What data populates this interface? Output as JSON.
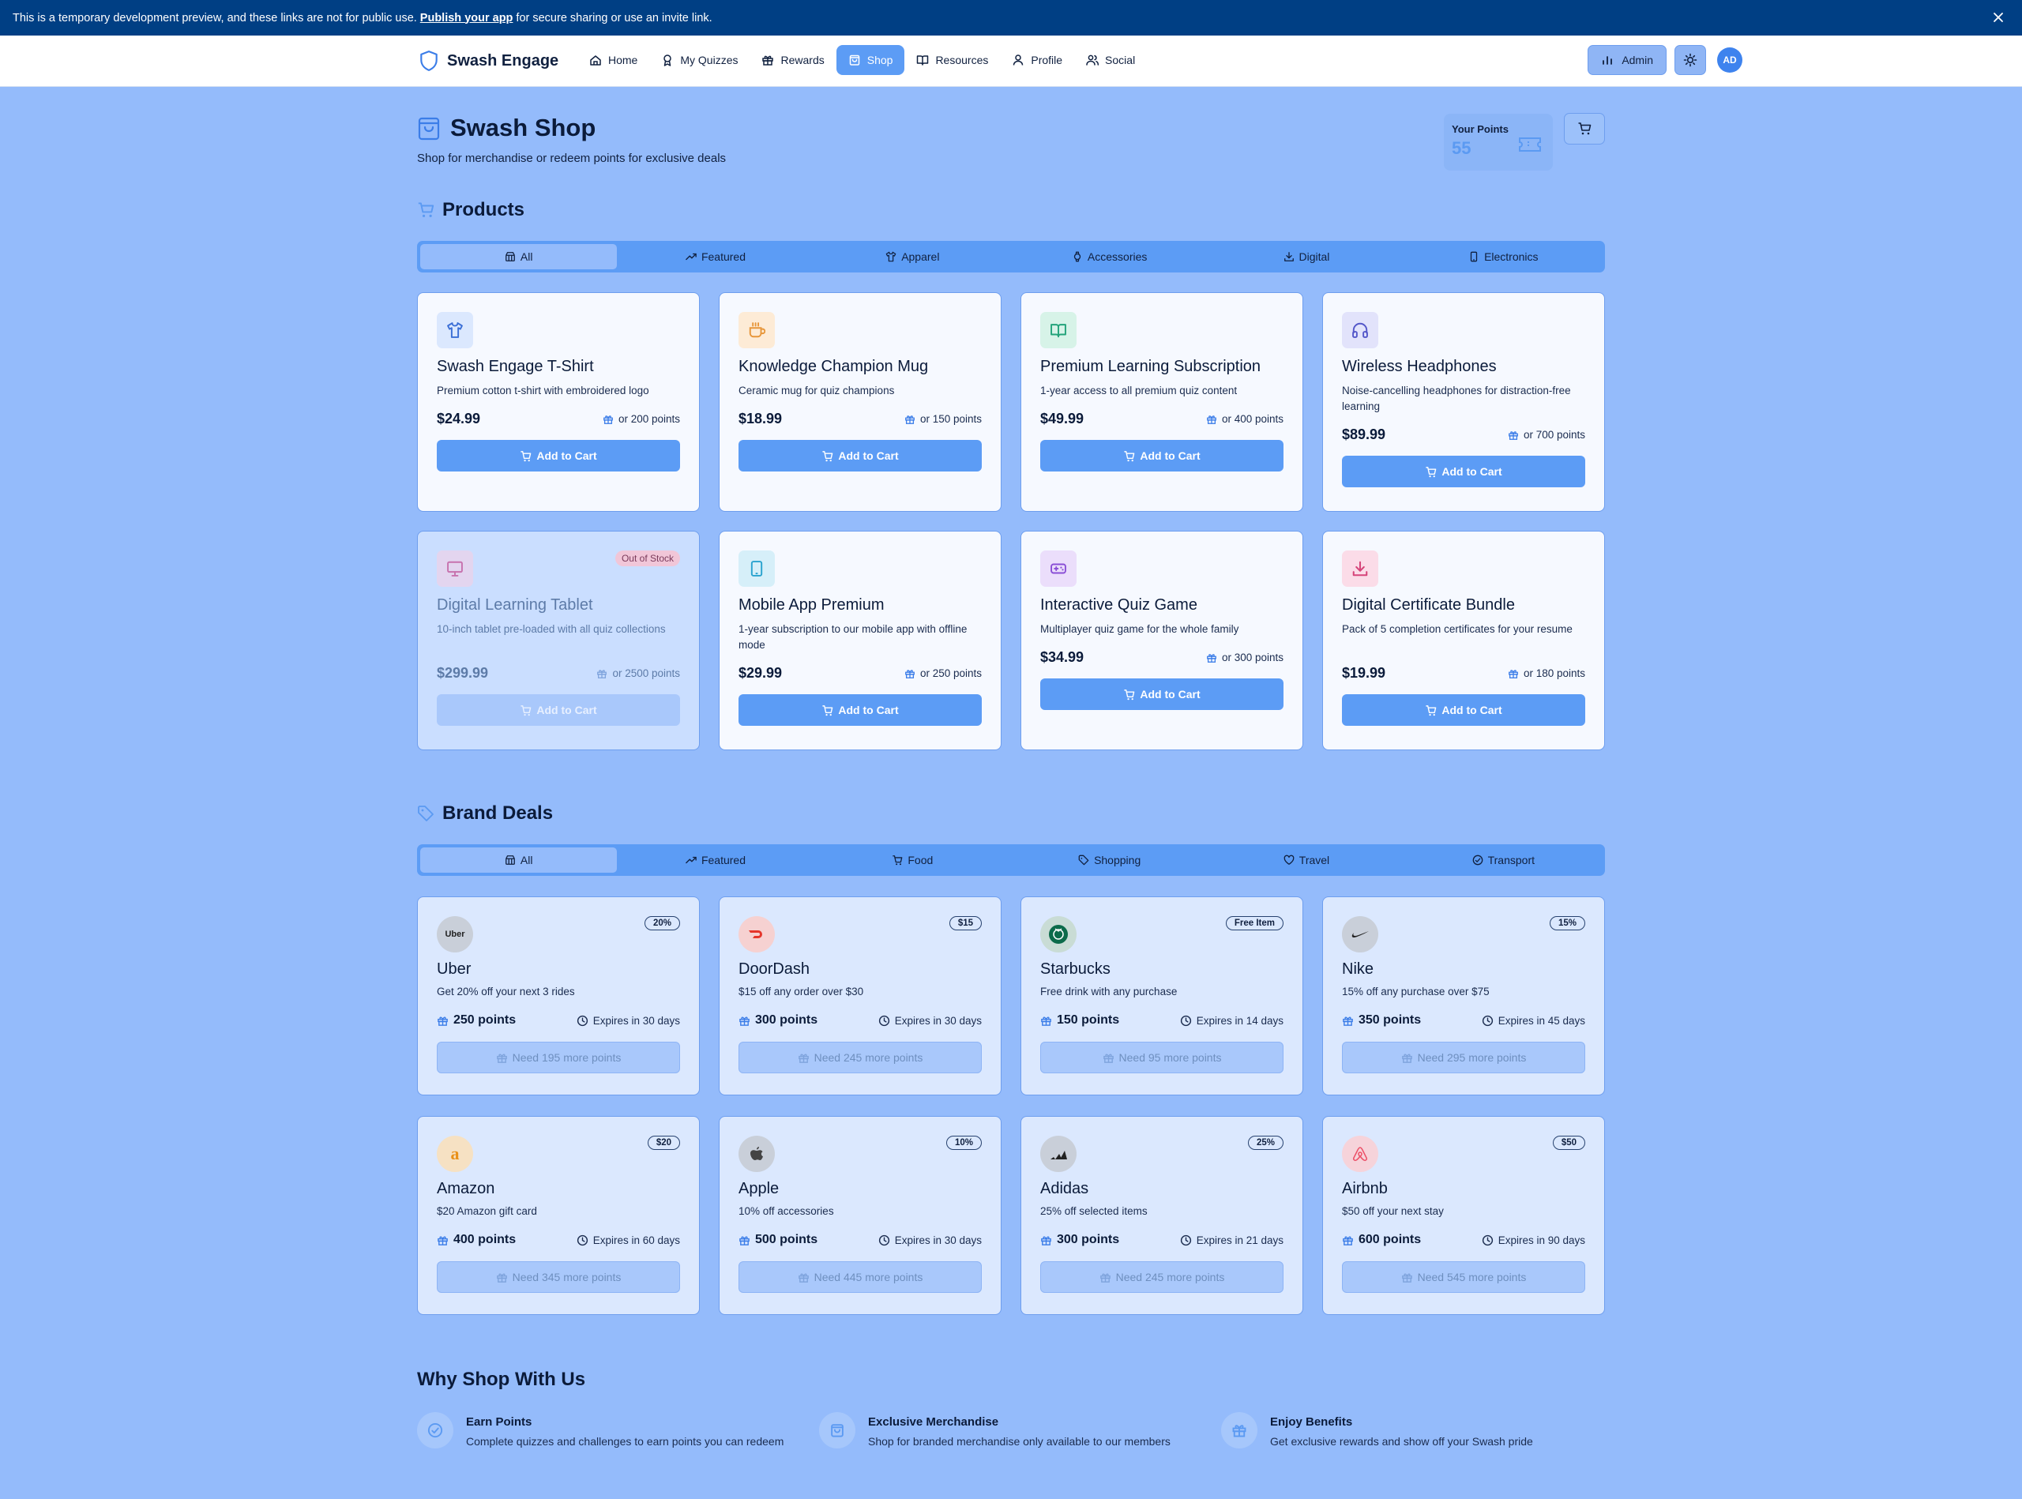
{
  "banner": {
    "text_before": "This is a temporary development preview, and these links are not for public use.",
    "link": "Publish your app",
    "text_after": "for secure sharing or use an invite link."
  },
  "nav": {
    "brand": "Swash Engage",
    "items": [
      {
        "label": "Home",
        "icon": "home-icon"
      },
      {
        "label": "My Quizzes",
        "icon": "award-icon"
      },
      {
        "label": "Rewards",
        "icon": "gift-icon"
      },
      {
        "label": "Shop",
        "icon": "shopping-bag-icon",
        "active": true
      },
      {
        "label": "Resources",
        "icon": "book-icon"
      },
      {
        "label": "Profile",
        "icon": "user-icon"
      },
      {
        "label": "Social",
        "icon": "users-icon"
      }
    ],
    "admin_label": "Admin",
    "avatar_initials": "AD"
  },
  "header": {
    "title": "Swash Shop",
    "subtitle": "Shop for merchandise or redeem points for exclusive deals",
    "points_label": "Your Points",
    "points_value": "55"
  },
  "products": {
    "heading": "Products",
    "tabs": [
      "All",
      "Featured",
      "Apparel",
      "Accessories",
      "Digital",
      "Electronics"
    ],
    "active_tab": "All",
    "items": [
      {
        "name": "Swash Engage T-Shirt",
        "desc": "Premium cotton t-shirt with embroidered logo",
        "price": "$24.99",
        "alt": "or 200 points",
        "button": "Add to Cart",
        "icon": "shirt-icon",
        "icon_color": "#3b6fd6",
        "icon_bg": "#dbe8fe",
        "out_of_stock": false
      },
      {
        "name": "Knowledge Champion Mug",
        "desc": "Ceramic mug for quiz champions",
        "price": "$18.99",
        "alt": "or 150 points",
        "button": "Add to Cart",
        "icon": "coffee-icon",
        "icon_color": "#e7963a",
        "icon_bg": "#fdebd6",
        "out_of_stock": false
      },
      {
        "name": "Premium Learning Subscription",
        "desc": "1-year access to all premium quiz content",
        "price": "$49.99",
        "alt": "or 400 points",
        "button": "Add to Cart",
        "icon": "book-open-icon",
        "icon_color": "#23a37a",
        "icon_bg": "#d7f3e8",
        "out_of_stock": false
      },
      {
        "name": "Wireless Headphones",
        "desc": "Noise-cancelling headphones for distraction-free learning",
        "price": "$89.99",
        "alt": "or 700 points",
        "button": "Add to Cart",
        "icon": "headphones-icon",
        "icon_color": "#5457c9",
        "icon_bg": "#e2e3fb",
        "out_of_stock": false
      },
      {
        "name": "Digital Learning Tablet",
        "desc": "10-inch tablet pre-loaded with all quiz collections",
        "price": "$299.99",
        "alt": "or 2500 points",
        "button": "Add to Cart",
        "icon": "monitor-icon",
        "icon_color": "#c64f93",
        "icon_bg": "#ecd3ea",
        "out_of_stock": true,
        "oos_label": "Out of Stock"
      },
      {
        "name": "Mobile App Premium",
        "desc": "1-year subscription to our mobile app with offline mode",
        "price": "$29.99",
        "alt": "or 250 points",
        "button": "Add to Cart",
        "icon": "tablet-icon",
        "icon_color": "#2aa3cf",
        "icon_bg": "#d6eff9",
        "out_of_stock": false
      },
      {
        "name": "Interactive Quiz Game",
        "desc": "Multiplayer quiz game for the whole family",
        "price": "$34.99",
        "alt": "or 300 points",
        "button": "Add to Cart",
        "icon": "gamepad-icon",
        "icon_color": "#8a4fd6",
        "icon_bg": "#ebdefb",
        "out_of_stock": false
      },
      {
        "name": "Digital Certificate Bundle",
        "desc": "Pack of 5 completion certificates for your resume",
        "price": "$19.99",
        "alt": "or 180 points",
        "button": "Add to Cart",
        "icon": "download-icon",
        "icon_color": "#d6457a",
        "icon_bg": "#fbdce8",
        "out_of_stock": false
      }
    ]
  },
  "deals": {
    "heading": "Brand Deals",
    "tabs": [
      "All",
      "Featured",
      "Food",
      "Shopping",
      "Travel",
      "Transport"
    ],
    "active_tab": "All",
    "items": [
      {
        "brand": "Uber",
        "logo_text": "Uber",
        "logo_bg": "#c9cfd9",
        "logo_color": "#222222",
        "badge": "20%",
        "desc": "Get 20% off your next 3 rides",
        "points": "250 points",
        "expires": "Expires in 30 days",
        "need": "Need 195 more points"
      },
      {
        "brand": "DoorDash",
        "logo_text": "",
        "logo_bg": "#f6d1d1",
        "logo_color": "#e5352b",
        "badge": "$15",
        "desc": "$15 off any order over $30",
        "points": "300 points",
        "expires": "Expires in 30 days",
        "need": "Need 245 more points"
      },
      {
        "brand": "Starbucks",
        "logo_text": "",
        "logo_bg": "#c9dcd5",
        "logo_color": "#0c6b4a",
        "badge": "Free Item",
        "desc": "Free drink with any purchase",
        "points": "150 points",
        "expires": "Expires in 14 days",
        "need": "Need 95 more points"
      },
      {
        "brand": "Nike",
        "logo_text": "",
        "logo_bg": "#c9cfd9",
        "logo_color": "#222222",
        "badge": "15%",
        "desc": "15% off any purchase over $75",
        "points": "350 points",
        "expires": "Expires in 45 days",
        "need": "Need 295 more points"
      },
      {
        "brand": "Amazon",
        "logo_text": "a",
        "logo_bg": "#f6e1c3",
        "logo_color": "#e99018",
        "badge": "$20",
        "desc": "$20 Amazon gift card",
        "points": "400 points",
        "expires": "Expires in 60 days",
        "need": "Need 345 more points"
      },
      {
        "brand": "Apple",
        "logo_text": "",
        "logo_bg": "#c9cfd9",
        "logo_color": "#444444",
        "badge": "10%",
        "desc": "10% off accessories",
        "points": "500 points",
        "expires": "Expires in 30 days",
        "need": "Need 445 more points"
      },
      {
        "brand": "Adidas",
        "logo_text": "",
        "logo_bg": "#c9cfd9",
        "logo_color": "#222222",
        "badge": "25%",
        "desc": "25% off selected items",
        "points": "300 points",
        "expires": "Expires in 21 days",
        "need": "Need 245 more points"
      },
      {
        "brand": "Airbnb",
        "logo_text": "",
        "logo_bg": "#f6d3da",
        "logo_color": "#ec5068",
        "badge": "$50",
        "desc": "$50 off your next stay",
        "points": "600 points",
        "expires": "Expires in 90 days",
        "need": "Need 545 more points"
      }
    ]
  },
  "why": {
    "heading": "Why Shop With Us",
    "features": [
      {
        "title": "Earn Points",
        "desc": "Complete quizzes and challenges to earn points you can redeem",
        "icon": "check-circle-icon"
      },
      {
        "title": "Exclusive Merchandise",
        "desc": "Shop for branded merchandise only available to our members",
        "icon": "shopping-bag-icon"
      },
      {
        "title": "Enjoy Benefits",
        "desc": "Get exclusive rewards and show off your Swash pride",
        "icon": "gift-icon"
      }
    ]
  },
  "colors": {
    "accent": "#5c9cf5",
    "background": "#94bbfb",
    "banner": "#003f84"
  }
}
